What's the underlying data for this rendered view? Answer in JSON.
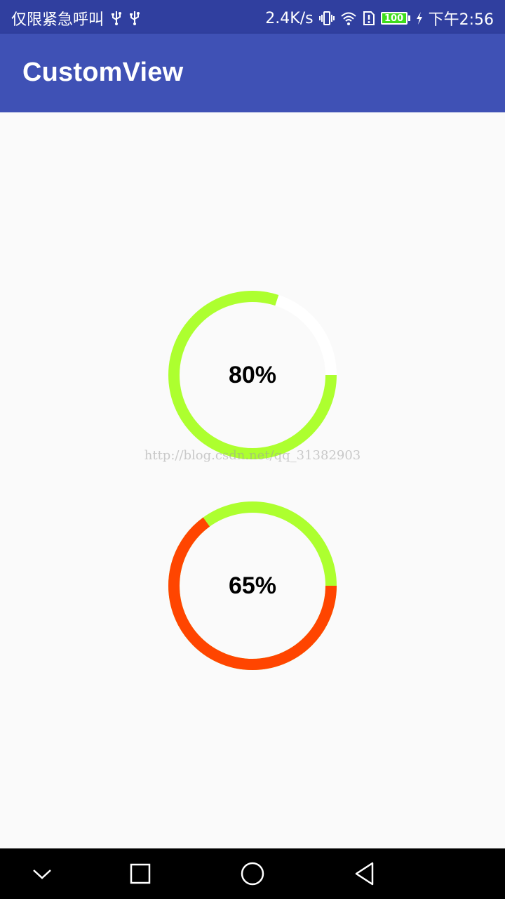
{
  "status_bar": {
    "carrier": "仅限紧急呼叫",
    "network_speed": "2.4K/s",
    "battery_level": "100",
    "time": "下午2:56",
    "icons": [
      "usb-icon",
      "usb-icon",
      "vibrate-icon",
      "wifi-icon",
      "sim-alert-icon",
      "battery-icon",
      "charging-icon"
    ]
  },
  "app_bar": {
    "title": "CustomView"
  },
  "rings": [
    {
      "label": "80%",
      "progress": 0.8,
      "progress_color": "#adff2f",
      "track_color": "#ffffff"
    },
    {
      "label": "65%",
      "progress": 0.65,
      "progress_color": "#ff4500",
      "track_color": "#adff2f"
    }
  ],
  "watermark": "http://blog.csdn.net/qq_31382903",
  "nav_bar": {
    "buttons": [
      "chevron-down-icon",
      "recents-square-icon",
      "home-circle-icon",
      "back-triangle-icon"
    ]
  },
  "colors": {
    "status_bar": "#303f9f",
    "app_bar": "#3f51b5",
    "background": "#fafafa"
  }
}
